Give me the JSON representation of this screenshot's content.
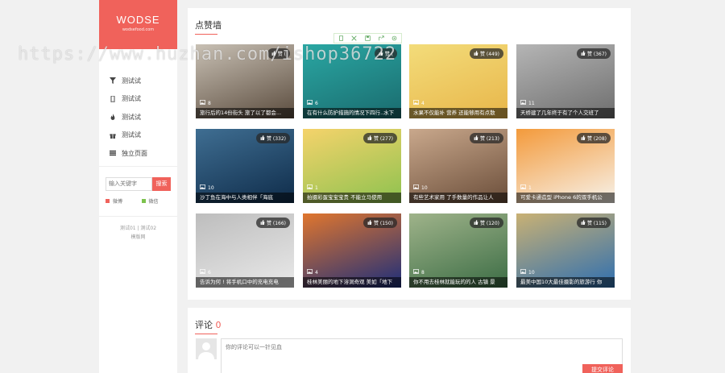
{
  "logo": {
    "name": "WODSE",
    "sub": "wodsefood.com"
  },
  "nav": [
    {
      "label": "测试试",
      "icon": "filter-icon"
    },
    {
      "label": "测试试",
      "icon": "mobile-icon"
    },
    {
      "label": "测试试",
      "icon": "fire-icon"
    },
    {
      "label": "测试试",
      "icon": "gift-icon"
    },
    {
      "label": "独立页面",
      "icon": "list-icon"
    }
  ],
  "search": {
    "placeholder": "输入关键字",
    "button": "搜索"
  },
  "legend": [
    {
      "label": "微博",
      "color": "#f0625b"
    },
    {
      "label": "微信",
      "color": "#7cc24d"
    }
  ],
  "footer": {
    "line1": "测试01 | 测试02",
    "line2": "模版网"
  },
  "watermark": "https://www.huzhan.com/ishop36722",
  "section": {
    "title": "点赞墙"
  },
  "tiles": [
    {
      "likes": "赞 (",
      "count": "8",
      "caption": "旅行后的14份街头 旅了以了都会...",
      "c1": "#5b4c3e",
      "c2": "#c8c0b4"
    },
    {
      "likes": "赞 (",
      "count": "6",
      "caption": "在有什么防护措施的情况下四行..水下",
      "c1": "#1a6b6e",
      "c2": "#2aa7a3"
    },
    {
      "likes": "赞 (449)",
      "count": "4",
      "caption": "水果不仅能补 营养 还能够用有点散",
      "c1": "#e8b64a",
      "c2": "#f3dc7a"
    },
    {
      "likes": "赞 (367)",
      "count": "11",
      "caption": "天桥建了几年终于有了个人交班了",
      "c1": "#6e6e6e",
      "c2": "#b5b5b5"
    },
    {
      "likes": "赞 (332)",
      "count": "10",
      "caption": "沙丁鱼在海中与人类相伴「海底",
      "c1": "#0f2c4a",
      "c2": "#3f6e92"
    },
    {
      "likes": "赞 (277)",
      "count": "1",
      "caption": "拍摄彩蛋宝宝宝贵 不能立马使用",
      "c1": "#8dc24f",
      "c2": "#f5d36b"
    },
    {
      "likes": "赞 (213)",
      "count": "10",
      "caption": "有些艺术家用 了手数量的作品让人",
      "c1": "#6b4e3a",
      "c2": "#c9a88c"
    },
    {
      "likes": "赞 (208)",
      "count": "1",
      "caption": "可爱卡通造型 iPhone 6的双手机公",
      "c1": "#f7f2ea",
      "c2": "#f39a3b"
    },
    {
      "likes": "赞 (166)",
      "count": "6",
      "caption": "告诉为何 ! 将手机口中的充电充电",
      "c1": "#e9e9e9",
      "c2": "#bdbdbd"
    },
    {
      "likes": "赞 (150)",
      "count": "4",
      "caption": "桂林美丽的地下溶洞奇观 美如「地下",
      "c1": "#1d2e7a",
      "c2": "#e0762e"
    },
    {
      "likes": "赞 (120)",
      "count": "8",
      "caption": "你不用去桂林就能玩的的人 古镇 景",
      "c1": "#3c6d45",
      "c2": "#9fb38a"
    },
    {
      "likes": "赞 (115)",
      "count": "10",
      "caption": "最美中国10大最佳摄影的旅游行 你",
      "c1": "#2f6fb0",
      "c2": "#c9b174"
    }
  ],
  "comments": {
    "title": "评论",
    "count": "0",
    "placeholder": "你的评论可以一针见血",
    "submit": "提交评论"
  }
}
